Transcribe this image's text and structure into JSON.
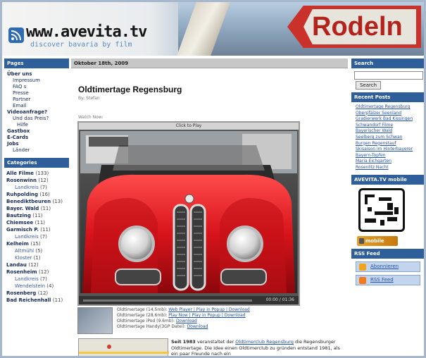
{
  "header": {
    "site_title": "www.avevita.tv",
    "tagline": "discover bavaria by film",
    "sign_text": "Rodeln"
  },
  "sidebar_left": {
    "pages_title": "Pages",
    "pages": [
      {
        "label": "Über uns",
        "level": 1
      },
      {
        "label": "Impressum",
        "level": 2
      },
      {
        "label": "FAQ s",
        "level": 2
      },
      {
        "label": "Presse",
        "level": 2
      },
      {
        "label": "Partner",
        "level": 2
      },
      {
        "label": "Email",
        "level": 2
      },
      {
        "label": "Videoanfrage?",
        "level": 1
      },
      {
        "label": "Und das Preis?",
        "level": 2
      },
      {
        "label": "Hilfe",
        "level": 3
      },
      {
        "label": "Gastbox",
        "level": 1
      },
      {
        "label": "E-Cards",
        "level": 1
      },
      {
        "label": "Jobs",
        "level": 1
      },
      {
        "label": "Länder",
        "level": 2
      }
    ],
    "categories_title": "Categories",
    "categories": [
      {
        "label": "Alle Filme",
        "count": "(133)",
        "sub": false
      },
      {
        "label": "Rosenwinn",
        "count": "(12)",
        "sub": false
      },
      {
        "label": "Landkreis",
        "count": "(7)",
        "sub": true
      },
      {
        "label": "Ruhpolding",
        "count": "(16)",
        "sub": false
      },
      {
        "label": "Benediktbeuren",
        "count": "(13)",
        "sub": false
      },
      {
        "label": "Bayer. Wald",
        "count": "(11)",
        "sub": false
      },
      {
        "label": "Bautzing",
        "count": "(11)",
        "sub": false
      },
      {
        "label": "Chiemsee",
        "count": "(11)",
        "sub": false
      },
      {
        "label": "Garmisch P.",
        "count": "(11)",
        "sub": false
      },
      {
        "label": "Landkreis",
        "count": "(7)",
        "sub": true
      },
      {
        "label": "Kelheim",
        "count": "(15)",
        "sub": false
      },
      {
        "label": "Altmühl",
        "count": "(5)",
        "sub": true
      },
      {
        "label": "Kloster",
        "count": "(1)",
        "sub": true
      },
      {
        "label": "Landau",
        "count": "(12)",
        "sub": false
      },
      {
        "label": "Rosenheim",
        "count": "(12)",
        "sub": false
      },
      {
        "label": "Landkreis",
        "count": "(7)",
        "sub": true
      },
      {
        "label": "Wendelstein",
        "count": "(4)",
        "sub": true
      },
      {
        "label": "Rosenberg",
        "count": "(12)",
        "sub": false
      },
      {
        "label": "Bad Reichenhall",
        "count": "(11)",
        "sub": false
      }
    ]
  },
  "main": {
    "date": "Oktober 18th, 2009",
    "post_title": "Oldtimertage Regensburg",
    "post_by": "By: Stefan",
    "watch_label": "Watch Now:",
    "player_title": "Click to Play",
    "player_time": "00:00 / 01:36",
    "downloads": [
      {
        "text": "Oldtimertage (14.5mb):",
        "links": "Web Player | Play in Popup | Download"
      },
      {
        "text": "Oldtimertage (28.6mb):",
        "links": "Play Now | Play in Popup | Download"
      },
      {
        "text": "Oldtimertage iPod (9.6mb):",
        "links": "Download"
      },
      {
        "text": "Oldtimertage Handy(3GP Datei):",
        "links": "Download"
      }
    ],
    "body_intro": "Seit 1983",
    "body_mid": " veranstaltet der ",
    "body_link": "Oldtimerclub Regensburg",
    "body_rest": " die Regensburger Oldtimertage. Die Idee einen Oldtimerclub zu gründen entstand 1981, als ein paar Freunde nach ein"
  },
  "sidebar_right": {
    "search_title": "Search",
    "search_value": "",
    "search_button": "Search",
    "recent_title": "Recent Posts",
    "recent_posts": [
      "Oldtimertage Regensburg",
      "Oberpfälzer Seenland",
      "Gradierwerk Bad Kissingen",
      "Schwandorf Filme",
      "Bayerischer Wald",
      "Seelberg zum Schwan",
      "Burgen Regenstauf",
      "Skisaison im Hinterbayerer",
      "Bayern-Topfen",
      "Maria Eichgarten",
      "Rosenlitz Nacht"
    ],
    "mobile_title": "AVEVITA.TV mobile",
    "mobile_badge": "mobile",
    "rss_title": "RSS Feed",
    "feed_items": [
      "Abonnieren",
      "RSS Feed"
    ]
  },
  "colors": {
    "sidebar_header": "#2e5f9a",
    "link": "#2451a8",
    "date_bar": "#c7c7c7"
  }
}
